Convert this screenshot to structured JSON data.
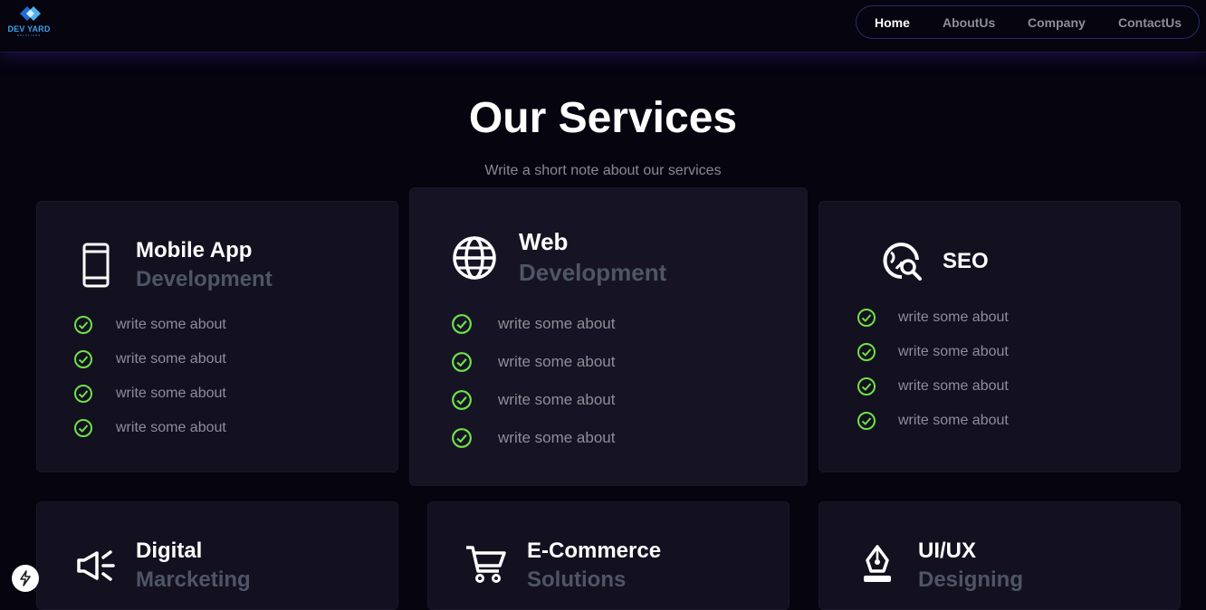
{
  "logo": {
    "main": "DEV YARD",
    "sub": "SOLUTIONS"
  },
  "nav": {
    "items": [
      {
        "label": "Home",
        "active": true
      },
      {
        "label": "AboutUs",
        "active": false
      },
      {
        "label": "Company",
        "active": false
      },
      {
        "label": "ContactUs",
        "active": false
      }
    ]
  },
  "section": {
    "title": "Our Services",
    "subtitle": "Write a short note about our services"
  },
  "cards": [
    {
      "icon": "mobile-phone-icon",
      "title": "Mobile App",
      "sub": "Development",
      "features": [
        "write some about",
        "write some about",
        "write some about",
        "write some about"
      ]
    },
    {
      "icon": "globe-icon",
      "title": "Web",
      "sub": "Development",
      "features": [
        "write some about",
        "write some about",
        "write some about",
        "write some about"
      ]
    },
    {
      "icon": "seo-search-icon",
      "title": "SEO",
      "sub": "",
      "features": [
        "write some about",
        "write some about",
        "write some about",
        "write some about"
      ]
    },
    {
      "icon": "megaphone-icon",
      "title": "Digital",
      "sub": "Marcketing",
      "features": []
    },
    {
      "icon": "shopping-cart-icon",
      "title": "E-Commerce",
      "sub": "Solutions",
      "features": []
    },
    {
      "icon": "pen-nib-icon",
      "title": "UI/UX",
      "sub": "Designing",
      "features": []
    }
  ],
  "colors": {
    "background": "#05040f",
    "card": "#13111f",
    "check": "#6fe04a",
    "muted": "#4e5566"
  },
  "fab": {
    "icon": "lightning-icon"
  }
}
